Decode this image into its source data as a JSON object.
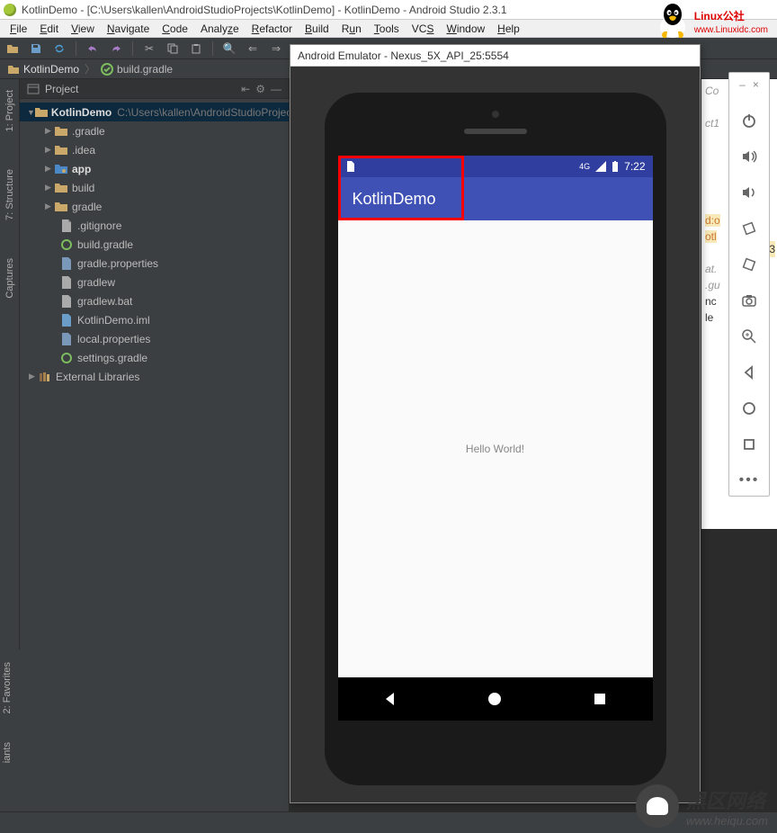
{
  "titlebar": "KotlinDemo - [C:\\Users\\kallen\\AndroidStudioProjects\\KotlinDemo] - KotlinDemo - Android Studio 2.3.1",
  "menu": [
    "File",
    "Edit",
    "View",
    "Navigate",
    "Code",
    "Analyze",
    "Refactor",
    "Build",
    "Run",
    "Tools",
    "VCS",
    "Window",
    "Help"
  ],
  "breadcrumb": {
    "project": "KotlinDemo",
    "file": "build.gradle"
  },
  "panel": {
    "title": "Project"
  },
  "tree": {
    "root": "KotlinDemo",
    "root_path": "C:\\Users\\kallen\\AndroidStudioProjects\\KotlinDemo",
    "items": [
      {
        "name": ".gradle",
        "type": "folder"
      },
      {
        "name": ".idea",
        "type": "folder"
      },
      {
        "name": "app",
        "type": "module"
      },
      {
        "name": "build",
        "type": "folder"
      },
      {
        "name": "gradle",
        "type": "folder"
      },
      {
        "name": ".gitignore",
        "type": "file"
      },
      {
        "name": "build.gradle",
        "type": "gradle"
      },
      {
        "name": "gradle.properties",
        "type": "props"
      },
      {
        "name": "gradlew",
        "type": "file"
      },
      {
        "name": "gradlew.bat",
        "type": "file"
      },
      {
        "name": "KotlinDemo.iml",
        "type": "iml"
      },
      {
        "name": "local.properties",
        "type": "props"
      },
      {
        "name": "settings.gradle",
        "type": "gradle"
      }
    ],
    "external": "External Libraries"
  },
  "side_tabs": {
    "project": "1: Project",
    "structure": "7: Structure",
    "captures": "Captures",
    "favorites": "2: Favorites",
    "variants": "iants"
  },
  "emulator": {
    "title": "Android Emulator - Nexus_5X_API_25:5554",
    "status_time": "7:22",
    "app_title": "KotlinDemo",
    "content": "Hello World!"
  },
  "code_peek": {
    "l1": "Co",
    "l2": "ct1",
    "l3": "d:o",
    "l4": "otl",
    "l5": ".3",
    "l6": "at.",
    "l7": ".gu",
    "l8": "nc",
    "l9": "le"
  },
  "logos": {
    "linux": "Linux公社",
    "linux_url": "www.Linuxidc.com",
    "heiqu": "黑区网络",
    "heiqu_url": "www.heiqu.com"
  }
}
